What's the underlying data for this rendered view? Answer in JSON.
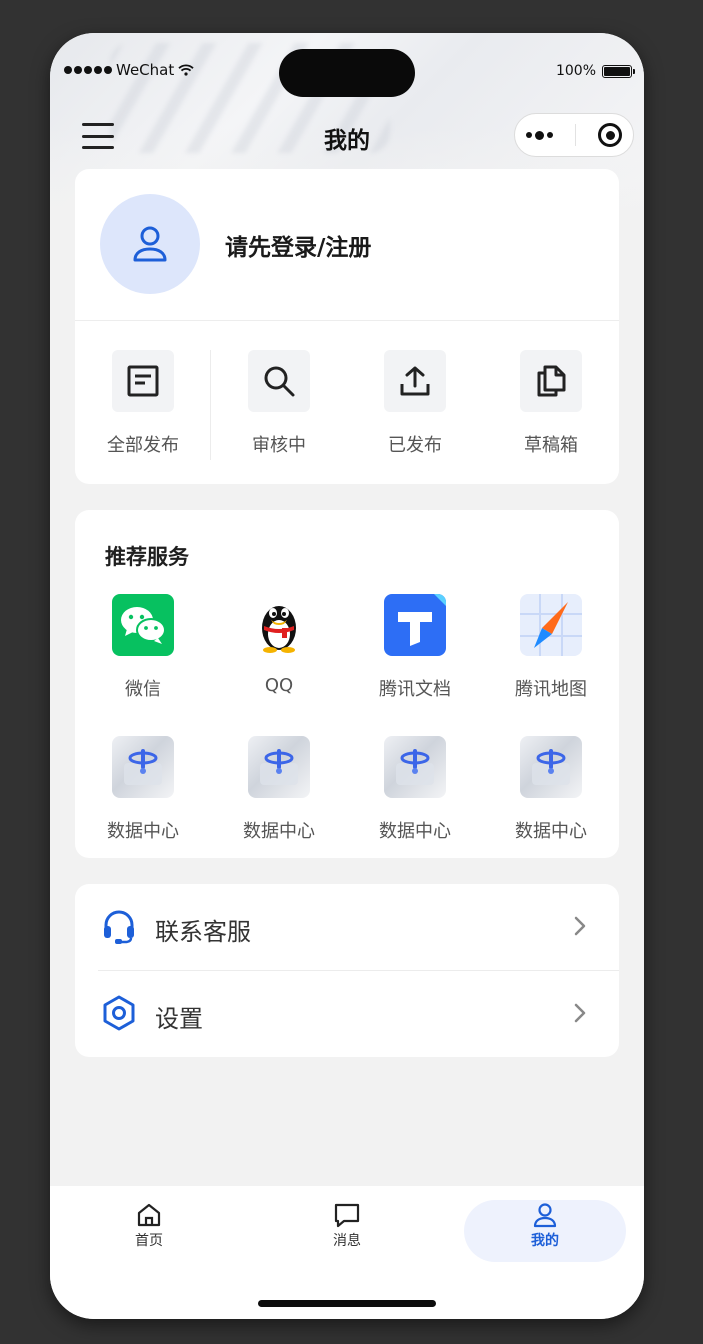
{
  "status_bar": {
    "carrier": "WeChat",
    "battery": "100%"
  },
  "nav": {
    "title": "我的"
  },
  "profile": {
    "login_text": "请先登录/注册"
  },
  "posts": [
    {
      "label": "全部发布",
      "icon": "document-icon"
    },
    {
      "label": "审核中",
      "icon": "search-icon"
    },
    {
      "label": "已发布",
      "icon": "upload-icon"
    },
    {
      "label": "草稿箱",
      "icon": "drafts-icon"
    }
  ],
  "services": {
    "title": "推荐服务",
    "items": [
      {
        "label": "微信",
        "icon": "wechat-icon"
      },
      {
        "label": "QQ",
        "icon": "qq-icon"
      },
      {
        "label": "腾讯文档",
        "icon": "tencent-docs-icon"
      },
      {
        "label": "腾讯地图",
        "icon": "tencent-maps-icon"
      },
      {
        "label": "数据中心",
        "icon": "data-center-icon"
      },
      {
        "label": "数据中心",
        "icon": "data-center-icon"
      },
      {
        "label": "数据中心",
        "icon": "data-center-icon"
      },
      {
        "label": "数据中心",
        "icon": "data-center-icon"
      }
    ]
  },
  "menu": [
    {
      "label": "联系客服",
      "icon": "headset-icon"
    },
    {
      "label": "设置",
      "icon": "settings-icon"
    }
  ],
  "tabbar": [
    {
      "label": "首页",
      "icon": "home-icon",
      "active": false
    },
    {
      "label": "消息",
      "icon": "message-icon",
      "active": false
    },
    {
      "label": "我的",
      "icon": "user-icon",
      "active": true
    }
  ],
  "colors": {
    "accent": "#1d5fd8",
    "page_bg": "#f2f2f2",
    "active_tab_bg": "#eef2fd"
  }
}
